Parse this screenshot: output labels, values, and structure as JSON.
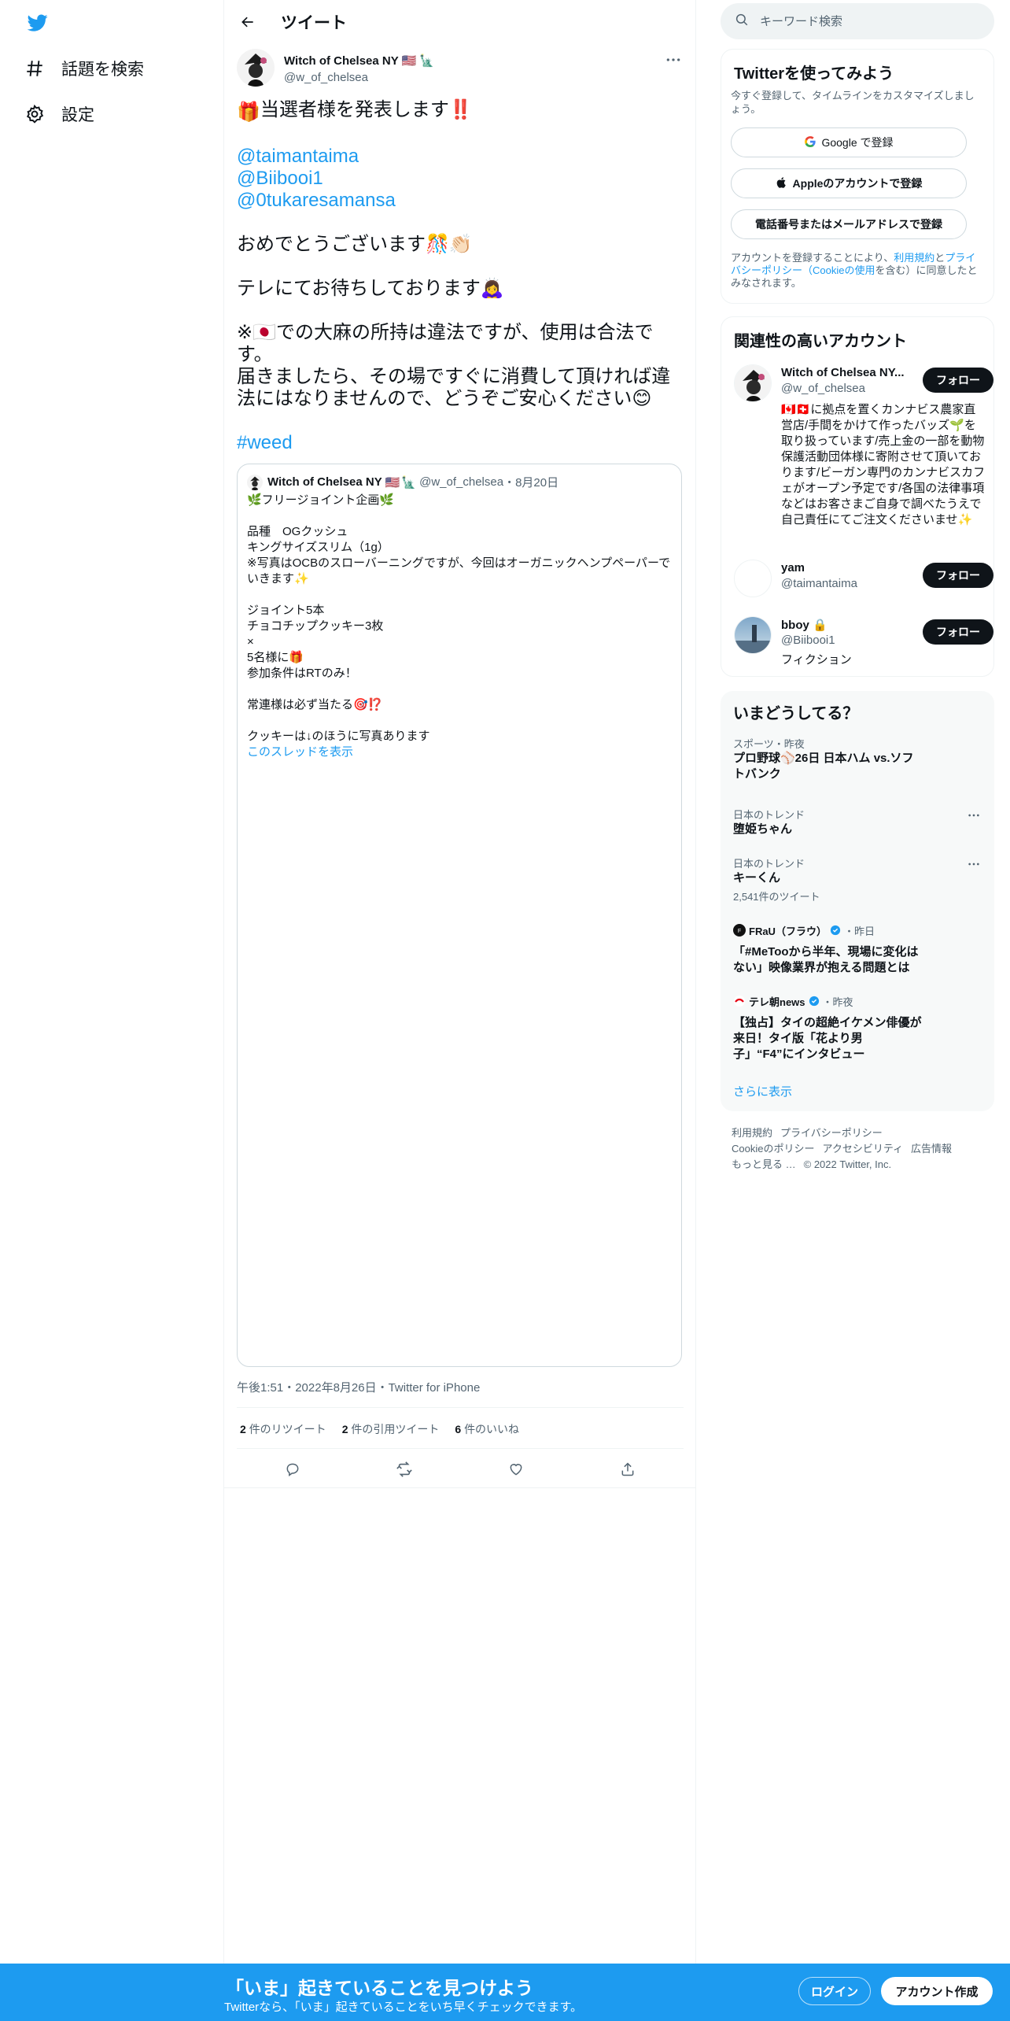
{
  "nav": {
    "items": [
      {
        "label": "話題を検索",
        "icon": "hashtag-icon"
      },
      {
        "label": "設定",
        "icon": "gear-icon"
      }
    ]
  },
  "header": {
    "title": "ツイート"
  },
  "tweet": {
    "author_name": "Witch of Chelsea NY",
    "author_handle": "@w_of_chelsea",
    "lines": [
      "当選者様を発表します‼️",
      "",
      "@taimantaima",
      "@Biibooi1",
      "@0tukaresamansa",
      "",
      "おめでとうございます🎊👏🏻",
      "",
      "テレにてお待ちしております🙇‍♀️",
      "",
      "※🇯🇵での大麻の所持は違法ですが、使用は合法です。",
      "届きましたら、その場ですぐに消費して頂ければ違法にはなりませんので、どうぞご安心ください😊",
      "",
      "#weed"
    ],
    "gift_emoji": "🎁",
    "time": "午後1:51・2022年8月26日・Twitter for iPhone",
    "stats": {
      "retweets_count": "2",
      "retweets_label": "件のリツイート",
      "quotes_count": "2",
      "quotes_label": "件の引用ツイート",
      "likes_count": "6",
      "likes_label": "件のいいね"
    }
  },
  "quote": {
    "author_name": "Witch of Chelsea NY",
    "author_handle": "@w_of_chelsea",
    "date": "・8月20日",
    "lines": [
      "🌿フリージョイント企画🌿",
      "",
      "品種　OGクッシュ",
      "キングサイズスリム（1g）",
      "※写真はOCBのスローバーニングですが、今回はオーガニックヘンプペーパーでいきます✨",
      "",
      "ジョイント5本",
      "チョコチップクッキー3枚",
      "×",
      "5名様に🎁",
      "参加条件はRTのみ！",
      "",
      "常連様は必ず当たる🎯⁉️",
      "",
      "クッキーは↓のほうに写真あります"
    ],
    "thread_link": "このスレッドを表示"
  },
  "search": {
    "placeholder": "キーワード検索"
  },
  "signup": {
    "title": "Twitterを使ってみよう",
    "subtitle": "今すぐ登録して、タイムラインをカスタマイズしましょう。",
    "google_btn": "Google で登録",
    "apple_btn": "Appleのアカウントで登録",
    "phone_btn": "電話番号またはメールアドレスで登録",
    "legal_prefix": "アカウントを登録することにより、",
    "legal_terms": "利用規約",
    "legal_and": "と",
    "legal_privacy": "プライバシーポリシー",
    "legal_cookie": "（Cookieの使用",
    "legal_suffix": "を含む）に同意したとみなされます。"
  },
  "related": {
    "title": "関連性の高いアカウント",
    "follow_label": "フォロー",
    "accounts": [
      {
        "name": "Witch of Chelsea NY...",
        "handle": "@w_of_chelsea",
        "bio": "🇨🇦🇨🇭に拠点を置くカンナビス農家直営店/手間をかけて作ったバッズ🌱を取り扱っています/売上金の一部を動物保護活動団体様に寄附させて頂いております/ビーガン専門のカンナビスカフェがオープン予定です/各国の法律事項などはお客さまご自身で調べたうえで自己責任にてご注文くださいませ✨"
      },
      {
        "name": "yam",
        "handle": "@taimantaima",
        "bio": ""
      },
      {
        "name": "bboy 🔒",
        "handle": "@Biibooi1",
        "bio": "フィクション"
      }
    ]
  },
  "trends": {
    "title": "いまどうしてる？",
    "items": [
      {
        "category": "スポーツ・昨夜",
        "title": "プロ野球⚾26日 日本ハム vs.ソフトバンク"
      },
      {
        "category": "日本のトレンド",
        "title": "堕姫ちゃん"
      },
      {
        "category": "日本のトレンド",
        "title": "キーくん",
        "count": "2,541件のツイート"
      }
    ],
    "news": [
      {
        "source": "FRaU（フラウ）",
        "time": "・昨日",
        "title": "「#MeTooから半年、現場に変化はない」映像業界が抱える問題とは"
      },
      {
        "source": "テレ朝news",
        "time": "・昨夜",
        "title": "【独占】タイの超絶イケメン俳優が来日！タイ版「花より男子」“F4”にインタビュー"
      }
    ],
    "show_more": "さらに表示"
  },
  "footer": {
    "links": [
      "利用規約",
      "プライバシーポリシー",
      "Cookieのポリシー",
      "アクセシビリティ",
      "広告情報",
      "もっと見る …",
      "© 2022 Twitter, Inc."
    ]
  },
  "banner": {
    "title": "「いま」起きていることを見つけよう",
    "subtitle": "Twitterなら、「いま」起きていることをいち早くチェックできます。",
    "login": "ログイン",
    "register": "アカウント作成"
  },
  "colors": {
    "accent": "#1d9bf0",
    "text": "#0f1419",
    "muted": "#536471"
  }
}
